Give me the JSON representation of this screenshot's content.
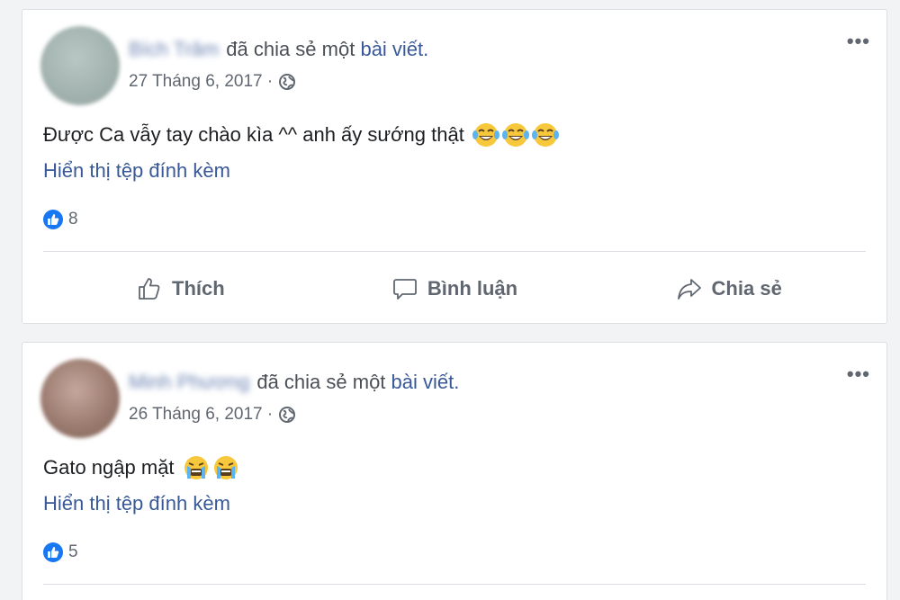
{
  "colors": {
    "link": "#385898",
    "like_blue": "#1877f2",
    "muted": "#606770",
    "text": "#1c1e21"
  },
  "posts": [
    {
      "author": "Bích Trâm",
      "shared_text": "đã chia sẻ một",
      "shared_link": "bài viết.",
      "timestamp": "27 Tháng 6, 2017 ·",
      "privacy_icon": "globe-icon",
      "text": "Được Ca vẫy tay chào kìa ^^ anh ấy sướng thật",
      "emojis": [
        "laughing-emoji",
        "laughing-emoji",
        "laughing-emoji"
      ],
      "attachment_link": "Hiển thị tệp đính kèm",
      "like_count": "8",
      "actions": {
        "like": "Thích",
        "comment": "Bình luận",
        "share": "Chia sẻ"
      },
      "more_icon": "more-options-icon"
    },
    {
      "author": "Minh Phương",
      "shared_text": "đã chia sẻ một",
      "shared_link": "bài viết.",
      "timestamp": "26 Tháng 6, 2017 ·",
      "privacy_icon": "globe-icon",
      "text": "Gato ngập mặt",
      "emojis": [
        "crying-emoji",
        "crying-emoji"
      ],
      "attachment_link": "Hiển thị tệp đính kèm",
      "like_count": "5",
      "more_icon": "more-options-icon"
    }
  ]
}
